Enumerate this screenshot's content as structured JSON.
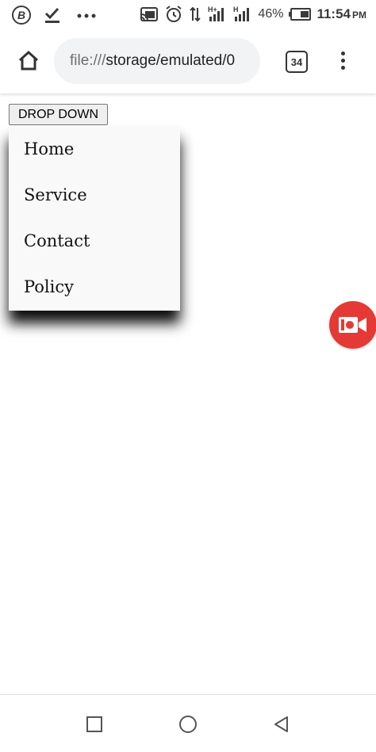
{
  "status_bar": {
    "left_icons": [
      "bitcoin-icon",
      "download-done-icon",
      "more-notifications-icon"
    ],
    "right_icons": [
      "cast-icon",
      "alarm-icon",
      "data-arrows-icon",
      "signal-h-plus-icon",
      "signal-h-icon"
    ],
    "battery_percent": "46%",
    "time": "11:54",
    "ampm": "PM"
  },
  "toolbar": {
    "url_scheme": "file:///",
    "url_path": "storage/emulated/0",
    "tab_count": "34",
    "icons": [
      "home-icon",
      "tab-switcher-icon",
      "overflow-menu-icon"
    ]
  },
  "page": {
    "dropdown_button_label": "DROP DOWN",
    "menu_items": [
      "Home",
      "Service",
      "Contact",
      "Policy"
    ]
  },
  "overlay": {
    "record_button_icon": "video-camera-icon",
    "record_button_color": "#e53935"
  },
  "nav_bar": {
    "icons": [
      "recent-apps-icon",
      "home-circle-icon",
      "back-triangle-icon"
    ]
  }
}
